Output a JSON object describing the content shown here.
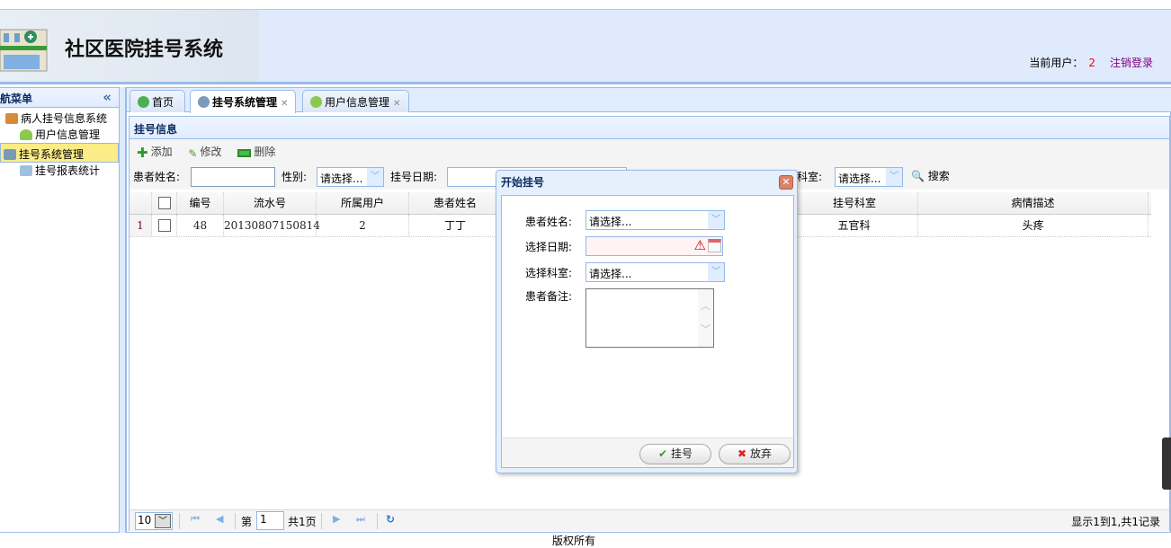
{
  "header": {
    "title": "社区医院挂号系统",
    "current_user_label": "当前用户：",
    "current_user": "2",
    "logout": "注销登录"
  },
  "nav": {
    "title": "导航菜单",
    "collapse_icon": "double-chevron-left-icon",
    "items": [
      {
        "label": "病人挂号信息系统"
      },
      {
        "label": "用户信息管理"
      },
      {
        "label": "挂号系统管理"
      },
      {
        "label": "挂号报表统计"
      }
    ]
  },
  "tabs": [
    {
      "label": "首页"
    },
    {
      "label": "挂号系统管理"
    },
    {
      "label": "用户信息管理"
    }
  ],
  "panel": {
    "title": "挂号信息"
  },
  "toolbar": {
    "add": "添加",
    "edit": "修改",
    "delete": "删除"
  },
  "search": {
    "name_label": "患者姓名:",
    "name_value": "",
    "gender_label": "性别:",
    "gender_value": "请选择...",
    "date_label": "挂号日期:",
    "dept_label": "科室:",
    "dept_value": "请选择...",
    "search": "搜索"
  },
  "grid": {
    "columns": [
      "编号",
      "流水号",
      "所属用户",
      "患者姓名",
      "挂号科室",
      "病情描述"
    ],
    "rows": [
      {
        "rownum": "1",
        "id": "48",
        "serial": "20130807150814",
        "user": "2",
        "name": "丁丁",
        "dept": "五官科",
        "desc": "头疼"
      }
    ]
  },
  "pager": {
    "page_size": "10",
    "page_label": "第",
    "page": "1",
    "total_pages": "共1页",
    "summary": "显示1到1,共1记录"
  },
  "footer": "版权所有",
  "dialog": {
    "title": "开始挂号",
    "name_label": "患者姓名:",
    "name_value": "请选择...",
    "date_label": "选择日期:",
    "date_value": "",
    "dept_label": "选择科室:",
    "dept_value": "请选择...",
    "note_label": "患者备注:",
    "note_value": "",
    "ok": "挂号",
    "cancel": "放弃"
  }
}
